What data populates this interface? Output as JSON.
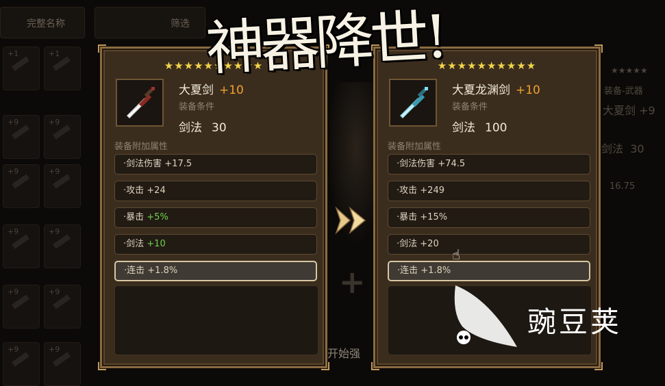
{
  "top_bar": {
    "tab_complete_name": "完整名称",
    "tab_filter": "筛选"
  },
  "banner_title": "神器降世!",
  "left_panel": {
    "stars": "★★★★★★★★★★",
    "item_name": "大夏剑",
    "enhance": "+10",
    "requirement_label": "装备条件",
    "requirement_name": "剑法",
    "requirement_value": "30",
    "attributes_title": "装备附加属性",
    "attributes": [
      {
        "name": "·剑法伤害",
        "value": "+17.5",
        "color": "#ded3bf"
      },
      {
        "name": "·攻击",
        "value": "+24",
        "color": "#ded3bf"
      },
      {
        "name": "·暴击",
        "value": "+5%",
        "color": "#6ed24a"
      },
      {
        "name": "·剑法",
        "value": "+10",
        "color": "#6ed24a"
      },
      {
        "name": "·连击",
        "value": "+1.8%",
        "color": "#ded3bf"
      }
    ]
  },
  "right_panel": {
    "stars": "★★★★★★★★★★",
    "item_name": "大夏龙渊剑",
    "enhance": "+10",
    "requirement_label": "装备条件",
    "requirement_name": "剑法",
    "requirement_value": "100",
    "attributes_title": "装备附加属性",
    "attributes": [
      {
        "name": "·剑法伤害",
        "value": "+74.5"
      },
      {
        "name": "·攻击",
        "value": "+249"
      },
      {
        "name": "·暴击",
        "value": "+15%"
      },
      {
        "name": "·剑法",
        "value": "+20"
      },
      {
        "name": "·连击",
        "value": "+1.8%"
      }
    ]
  },
  "right_peek": {
    "stars": "★★★★★",
    "category": "装备-武器",
    "name": "大夏剑",
    "enhance": "+9",
    "req_name": "剑法",
    "req_value": "30",
    "stat": "16.75"
  },
  "background_grid": {
    "badge_values": [
      "+1",
      "+9",
      "+9",
      "+9",
      "+9",
      "+9"
    ]
  },
  "start_button_label": "开始强",
  "watermark_text": "豌豆荚",
  "colors": {
    "panel_bg": "#3b2d1d",
    "panel_border": "#8a6b41",
    "star": "#f3d54a",
    "enhance": "#f0a030",
    "green_value": "#6ed24a"
  }
}
